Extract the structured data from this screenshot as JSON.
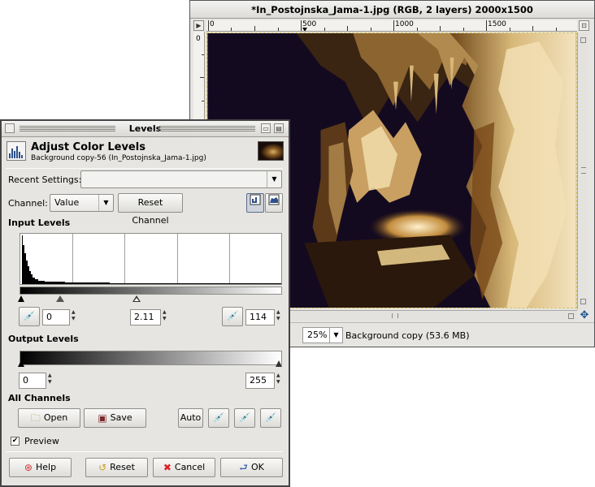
{
  "image_window": {
    "title": "*In_Postojnska_Jama-1.jpg (RGB, 2 layers) 2000x1500",
    "ruler_labels": [
      "0",
      "500",
      "1000",
      "1500"
    ],
    "vruler_label": "0",
    "zoom": "25%",
    "status": "Background copy (53.6 MB)"
  },
  "dialog": {
    "title": "Levels",
    "heading": "Adjust Color Levels",
    "subheading": "Background copy-56 (In_Postojnska_Jama-1.jpg)",
    "recent_settings_label": "Recent Settings:",
    "recent_settings_value": "",
    "channel_label": "Channel:",
    "channel_value": "Value",
    "reset_channel": "Reset Channel",
    "input_levels": "Input Levels",
    "input_low": "0",
    "input_gamma": "2.11",
    "input_high": "114",
    "output_levels": "Output Levels",
    "output_low": "0",
    "output_high": "255",
    "all_channels": "All Channels",
    "open": "Open",
    "save": "Save",
    "auto": "Auto",
    "preview": "Preview",
    "preview_checked": true,
    "help": "Help",
    "reset": "Reset",
    "cancel": "Cancel",
    "ok": "OK"
  },
  "colors": {
    "canvas_dark": "#140a20",
    "rock_light": "#e9d4a6",
    "selection": "#d6c15e"
  }
}
